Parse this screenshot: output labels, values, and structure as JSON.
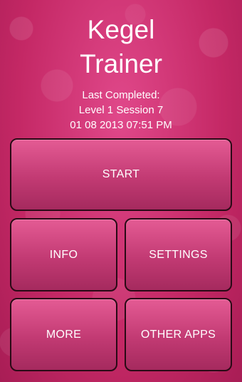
{
  "app": {
    "title_line1": "Kegel",
    "title_line2": "Trainer"
  },
  "status": {
    "line1": "Last Completed:",
    "line2": "Level 1 Session 7",
    "line3": "01 08 2013 07:51 PM"
  },
  "buttons": {
    "start": "START",
    "info": "INFO",
    "settings": "SETTINGS",
    "more": "MORE",
    "other_apps": "OTHER APPS"
  },
  "colors": {
    "background": "#c92a68",
    "button_top": "#e45b94",
    "button_bottom": "#a52a5e",
    "button_border": "#2a0a16",
    "text": "#ffffff"
  }
}
